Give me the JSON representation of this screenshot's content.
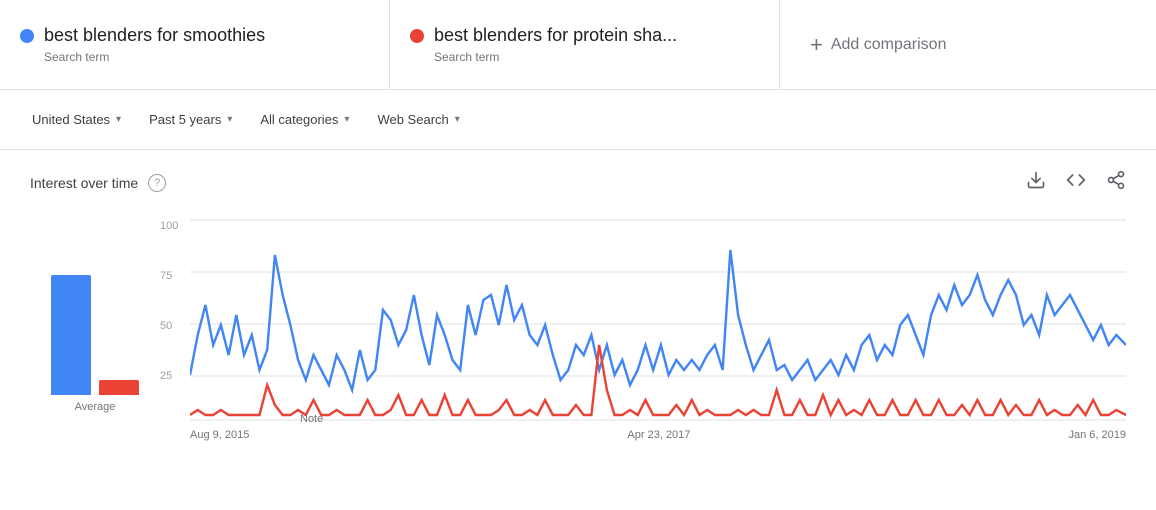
{
  "search_terms": [
    {
      "id": "term1",
      "title": "best blenders for smoothies",
      "subtitle": "Search term",
      "dot_color": "blue"
    },
    {
      "id": "term2",
      "title": "best blenders for protein sha...",
      "subtitle": "Search term",
      "dot_color": "red"
    }
  ],
  "add_comparison_label": "Add comparison",
  "filters": {
    "location": "United States",
    "time": "Past 5 years",
    "category": "All categories",
    "type": "Web Search"
  },
  "chart": {
    "title": "Interest over time",
    "help_icon": "?",
    "download_icon": "⬇",
    "embed_icon": "<>",
    "share_icon": "share",
    "x_labels": [
      "Aug 9, 2015",
      "Apr 23, 2017",
      "Jan 6, 2019"
    ],
    "y_labels": [
      "100",
      "75",
      "50",
      "25",
      ""
    ],
    "avg_label": "Average",
    "note_label": "Note"
  }
}
